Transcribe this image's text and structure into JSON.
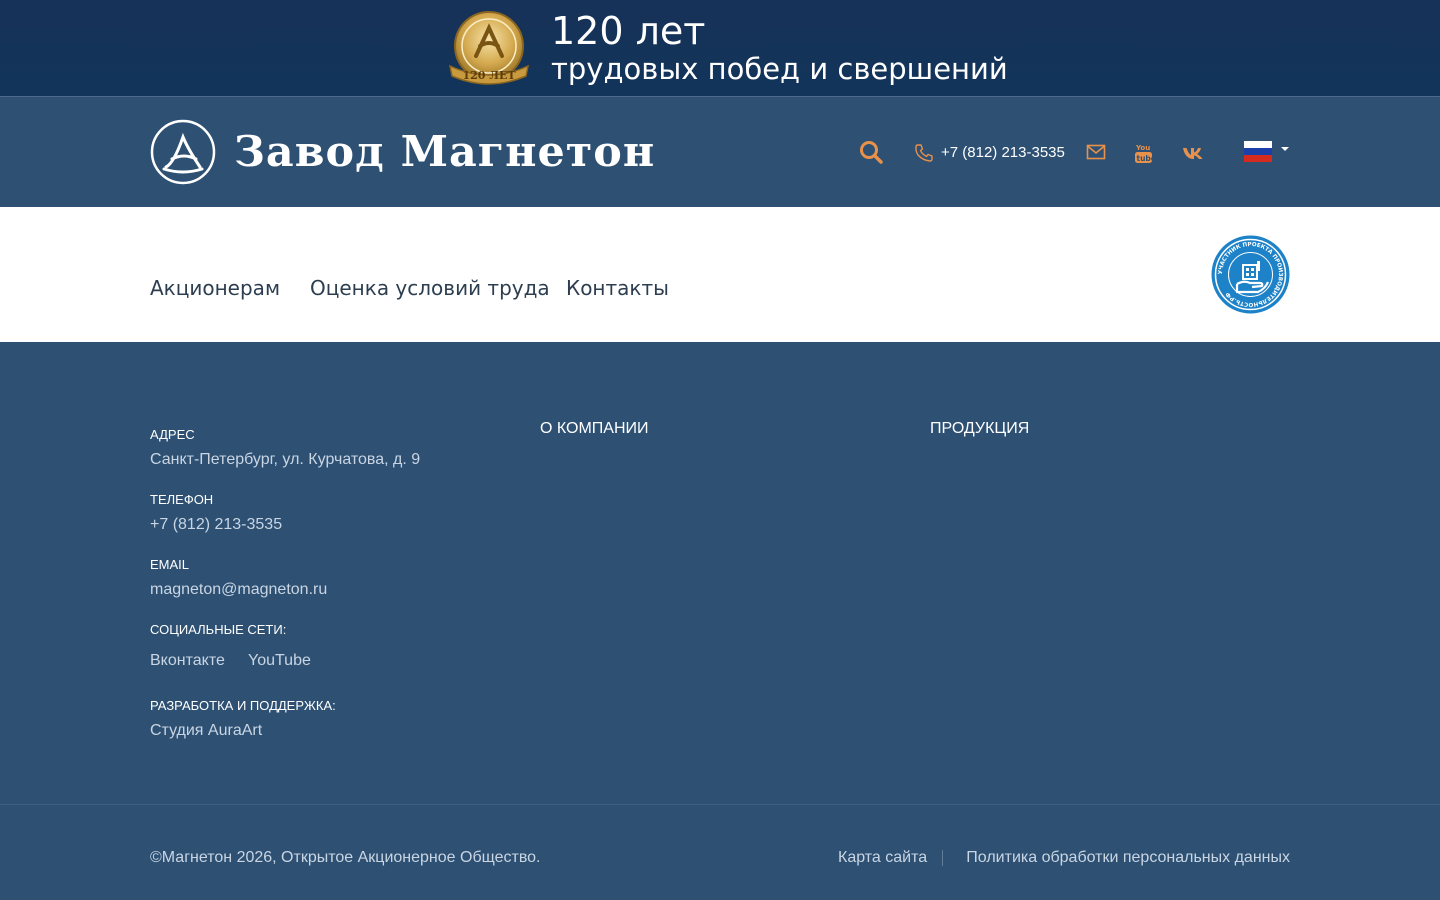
{
  "banner": {
    "title": "120 лет",
    "subtitle": "трудовых побед и свершений",
    "medal_label": "120 ЛЕТ"
  },
  "header": {
    "logo_text": "Завод Магнетон",
    "phone": "+7 (812) 213-3535",
    "accent_color": "#e8914a",
    "icons": [
      "search-icon",
      "phone-icon",
      "mail-icon",
      "youtube-icon",
      "vk-icon",
      "flag-ru-icon"
    ]
  },
  "nav": {
    "items": [
      "Акционерам",
      "Оценка условий труда",
      "Контакты"
    ],
    "badge_text": "УЧАСТНИК ПРОЕКТА ПРОИЗВОДИТЕЛЬНОСТЬ.РФ"
  },
  "footer": {
    "address_label": "Адрес",
    "address": "Санкт-Петербург, ул. Курчатова, д. 9",
    "phone_label": "Телефон",
    "phone": "+7 (812) 213-3535",
    "email_label": "Email",
    "email": "magneton@magneton.ru",
    "social_label": "Социальные сети:",
    "social_links": [
      "Вконтакте",
      "YouTube"
    ],
    "dev_label": "Разработка и поддержка:",
    "dev": "Студия AuraArt",
    "col2_title": "О компании",
    "col3_title": "Продукция"
  },
  "bottom": {
    "copyright": "©Магнетон 2026, Открытое Акционерное Общество.",
    "sitemap": "Карта сайта",
    "privacy": "Политика обработки персональных данных"
  }
}
